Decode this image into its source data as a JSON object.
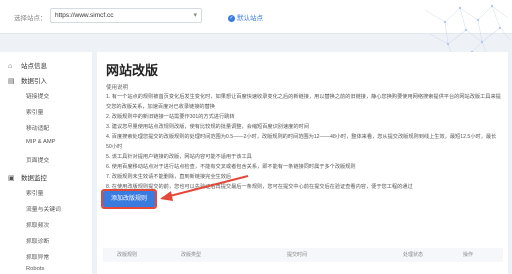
{
  "topbar": {
    "site_label": "选择站点：",
    "site_value": "https://www.simcf.cc",
    "default_link": "默认站点"
  },
  "sidebar": {
    "sections": [
      {
        "icon": "home-icon",
        "label": "站点信息"
      },
      {
        "icon": "document-icon",
        "label": "数据引入",
        "items": [
          "链接提交",
          "索引量",
          "移动适配",
          "MIP & AMP",
          "页面提交"
        ]
      },
      {
        "icon": "monitor-icon",
        "label": "数据监控",
        "items": [
          "索引量",
          "流量与关键词",
          "抓取频次",
          "抓取诊断",
          "抓取异常",
          "Robots"
        ]
      }
    ]
  },
  "main": {
    "title": "网站改版",
    "usage_title": "使用说明",
    "rules": [
      "1. 有一个站点的规则被首页变化后发生变化时，如果想让百度快速收录变化之后的新链接，用以替换之前的旧链接，静心您换购要使用网络搜索提供平台的网站改版工具来提交您的改版关系，加速百度对已收录链接的替换",
      "2. 改版规则中的新旧链接一站需要作301的方式进行跳转",
      "3. 建议您尽量使用站点改规则改版，使有比较规的批量调整，会缩短百度识别速度的时间",
      "4. 百度搜索处理您提交的改版规则的处理时间范围为0.5——2小时，改版规则的时间范围为12——48小时，整体来看，您从提交改版规则到线上生效，最短12.5小时，最长50小时",
      "5. 该工具针对提用户链接的改版，网站内容可能不适用于该工具",
      "6. 使用百度移动站点对于进行站点检查，不能有交叉或者包含关系，即不能有一条链接同时属于多个改版规则",
      "7. 改版规则未生效请不能删除，直到新链接完全生效后",
      "8. 在使用改版规则提交的前，您也可以先验证后再提交最后一条规则，您可在提交中心前在提交后在验证查看内容，便于您工程的通过"
    ],
    "add_button": "添加改版规则",
    "table_columns": [
      "改版规则",
      "改版类型",
      "提交时间",
      "处理状态",
      "操作"
    ]
  }
}
